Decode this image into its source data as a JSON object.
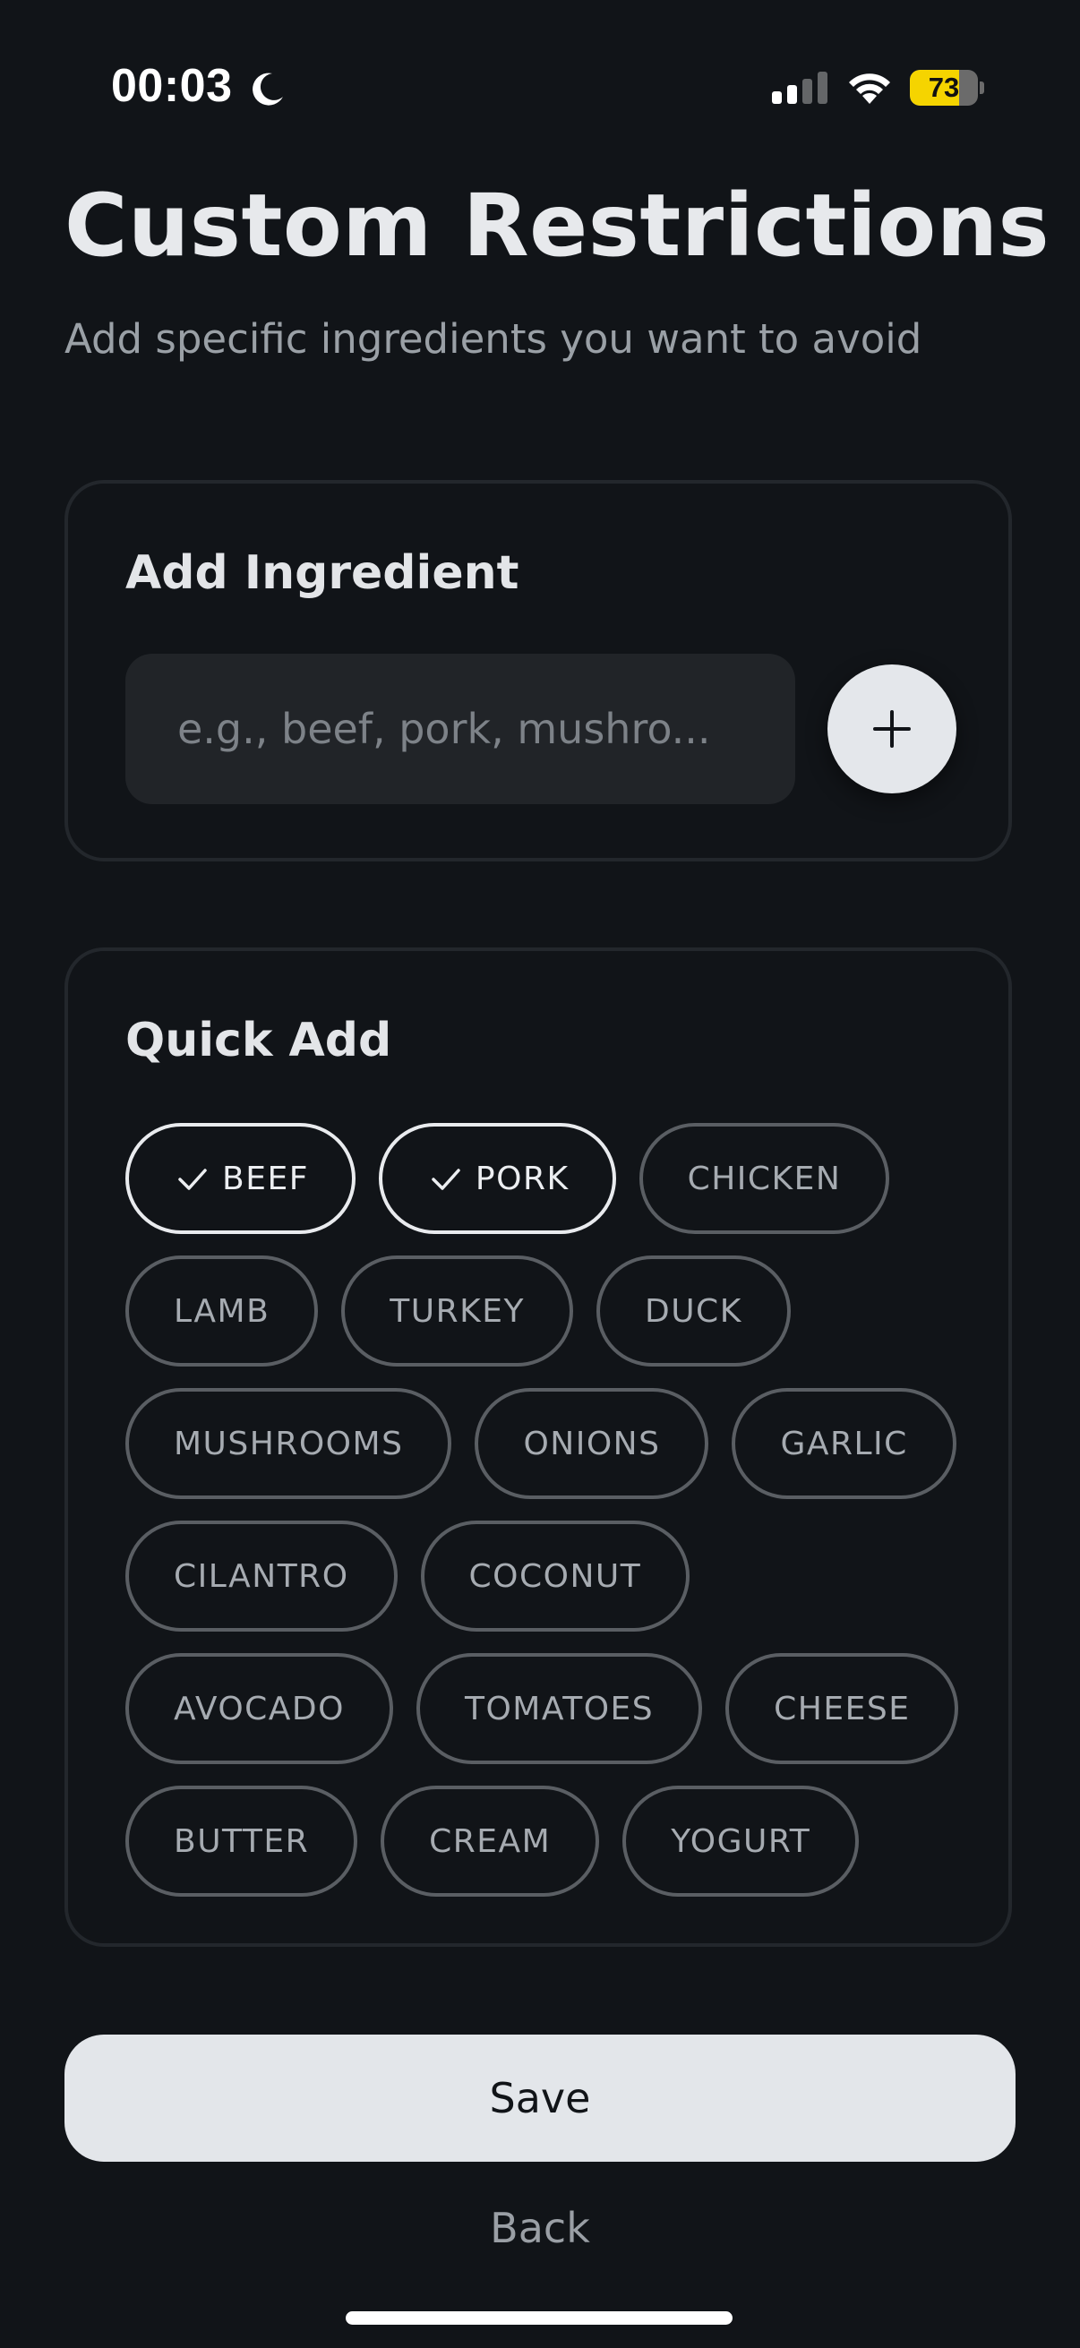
{
  "status_bar": {
    "time": "00:03",
    "battery_percent": "73",
    "battery_level": 0.73,
    "icons": [
      "moon-icon",
      "signal-icon",
      "wifi-icon",
      "battery-icon"
    ]
  },
  "header": {
    "title": "Custom Restrictions",
    "subtitle": "Add specific ingredients you want to avoid"
  },
  "add_ingredient": {
    "heading": "Add Ingredient",
    "input_value": "",
    "input_placeholder": "e.g., beef, pork, mushro...",
    "add_icon": "plus-icon"
  },
  "quick_add": {
    "heading": "Quick Add",
    "chips": [
      {
        "label": "BEEF",
        "selected": true
      },
      {
        "label": "PORK",
        "selected": true
      },
      {
        "label": "CHICKEN",
        "selected": false
      },
      {
        "label": "LAMB",
        "selected": false
      },
      {
        "label": "TURKEY",
        "selected": false
      },
      {
        "label": "DUCK",
        "selected": false
      },
      {
        "label": "MUSHROOMS",
        "selected": false
      },
      {
        "label": "ONIONS",
        "selected": false
      },
      {
        "label": "GARLIC",
        "selected": false
      },
      {
        "label": "CILANTRO",
        "selected": false
      },
      {
        "label": "COCONUT",
        "selected": false
      },
      {
        "label": "AVOCADO",
        "selected": false
      },
      {
        "label": "TOMATOES",
        "selected": false
      },
      {
        "label": "CHEESE",
        "selected": false
      },
      {
        "label": "BUTTER",
        "selected": false
      },
      {
        "label": "CREAM",
        "selected": false
      },
      {
        "label": "YOGURT",
        "selected": false
      }
    ]
  },
  "footer": {
    "save_label": "Save",
    "back_label": "Back"
  },
  "colors": {
    "background": "#111418",
    "card_border": "#23272c",
    "chip_border": "#5a5e63",
    "chip_selected_border": "#e9ebee",
    "save_button": "#e3e6ea",
    "battery_fill": "#f5d400"
  }
}
